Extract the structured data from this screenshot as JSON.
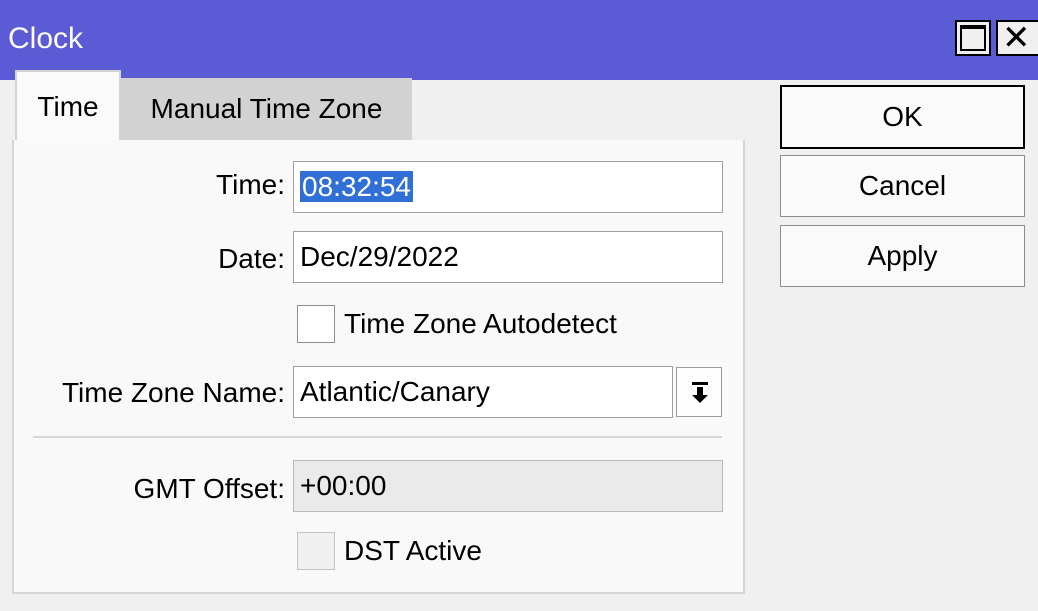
{
  "window": {
    "title": "Clock"
  },
  "tabs": [
    {
      "label": "Time",
      "active": true
    },
    {
      "label": "Manual Time Zone",
      "active": false
    }
  ],
  "form": {
    "time": {
      "label": "Time:",
      "value": "08:32:54"
    },
    "date": {
      "label": "Date:",
      "value": "Dec/29/2022"
    },
    "tz_autodetect": {
      "label": "Time Zone Autodetect",
      "checked": false
    },
    "tz_name": {
      "label": "Time Zone Name:",
      "value": "Atlantic/Canary"
    },
    "gmt_offset": {
      "label": "GMT Offset:",
      "value": "+00:00"
    },
    "dst_active": {
      "label": "DST Active",
      "checked": false
    }
  },
  "buttons": {
    "ok": "OK",
    "cancel": "Cancel",
    "apply": "Apply"
  },
  "colors": {
    "titlebar": "#5b5bd6",
    "selection": "#2f6fd6"
  }
}
